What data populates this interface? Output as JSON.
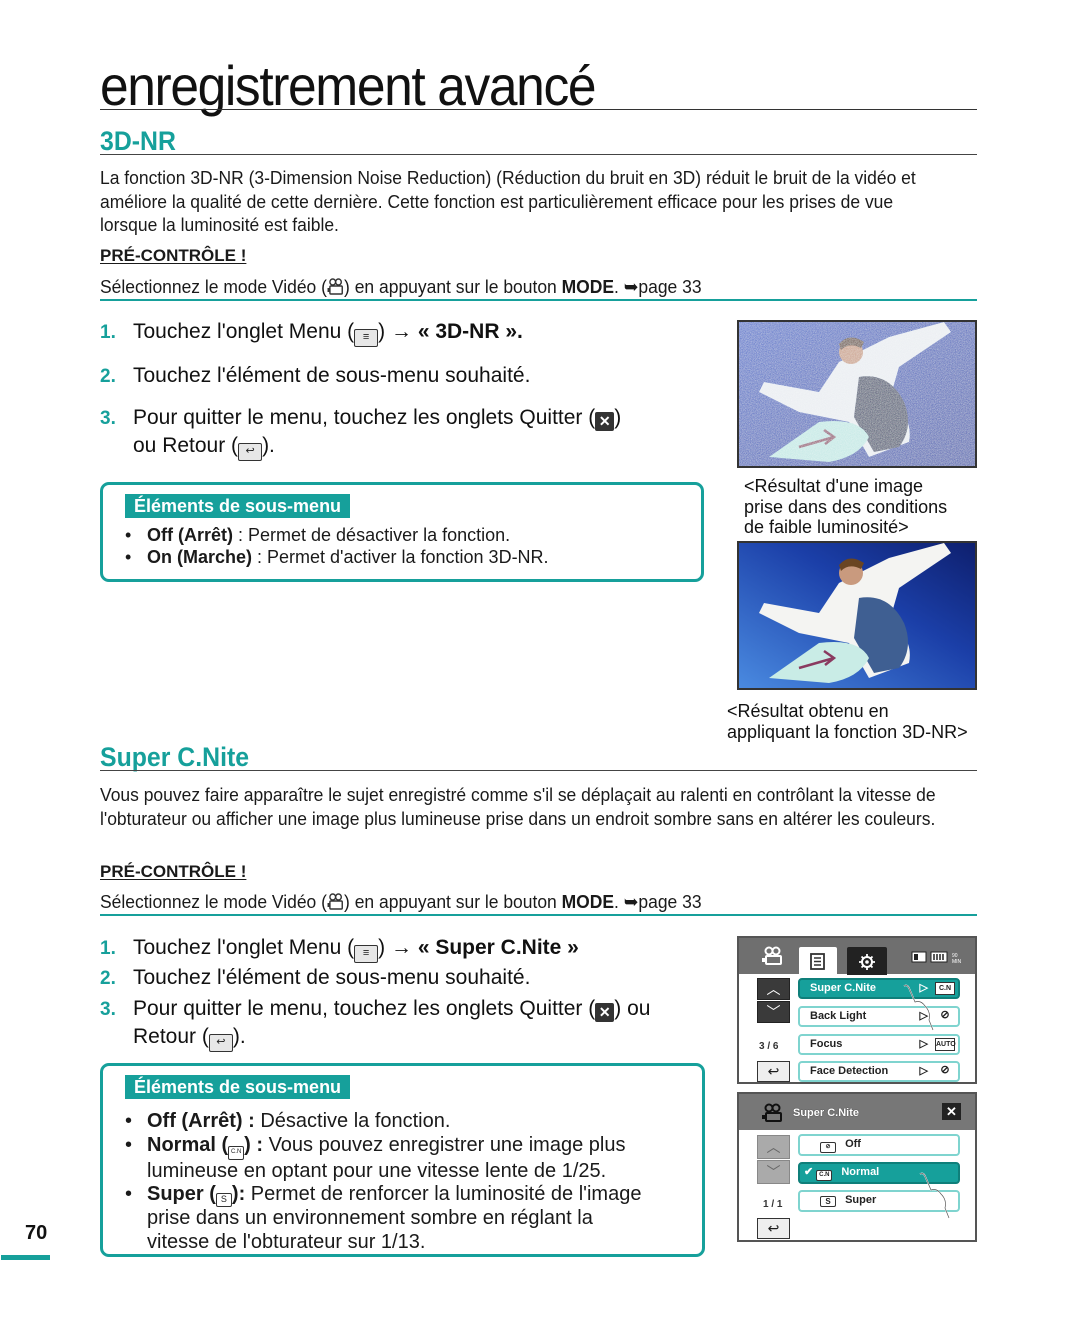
{
  "page": {
    "title": "enregistrement avancé",
    "number": "70",
    "accent_color": "#16a09b"
  },
  "sections": [
    {
      "heading": "3D-NR",
      "intro": "La fonction 3D-NR (3-Dimension Noise Reduction) (Réduction du bruit en 3D) réduit le bruit de la vidéo et améliore la qualité de cette dernière. Cette fonction est particulièrement efficace pour les prises de vue lorsque la luminosité est faible.",
      "precheck_label": "PRÉ-CONTRÔLE !",
      "precheck": {
        "before_icon": "Sélectionnez le mode Vidéo (",
        "after_icon": ") en appuyant sur le bouton ",
        "bold": "MODE",
        "after_bold": ". ➥page 33"
      },
      "steps": [
        {
          "num": "1.",
          "text_before": "Touchez l'onglet Menu (",
          "text_after": ") → ",
          "bold": "« 3D-NR »."
        },
        {
          "num": "2.",
          "text": "Touchez l'élément de sous-menu souhaité."
        },
        {
          "num": "3.",
          "line1_before": "Pour quitter le menu, touchez les onglets Quitter (",
          "line1_after": ")",
          "line2_before": "ou Retour (",
          "line2_after": ")."
        }
      ],
      "submenu": {
        "title": "Éléments de sous-menu",
        "items": [
          {
            "bold": "Off (Arrêt)",
            "text": " : Permet de désactiver la fonction."
          },
          {
            "bold": "On (Marche)",
            "text": " : Permet d'activer la fonction 3D-NR."
          }
        ]
      },
      "images": [
        {
          "caption": "<Résultat d'une image prise dans des conditions de faible luminosité>",
          "caption_lines": [
            "<Résultat d'une image",
            "prise dans des conditions",
            "de faible luminosité>"
          ],
          "state": "noisy"
        },
        {
          "caption": "<Résultat obtenu en appliquant la fonction 3D-NR>",
          "caption_lines": [
            "<Résultat obtenu en",
            "appliquant la fonction 3D-NR>"
          ],
          "state": "clean"
        }
      ]
    },
    {
      "heading": "Super C.Nite",
      "intro": "Vous pouvez faire apparaître le sujet enregistré comme s'il se déplaçait au ralenti en contrôlant la vitesse de l'obturateur ou afficher une image plus lumineuse prise dans un endroit sombre sans en altérer les couleurs.",
      "precheck_label": "PRÉ-CONTRÔLE !",
      "precheck": {
        "before_icon": "Sélectionnez le mode Vidéo (",
        "after_icon": ") en appuyant sur le bouton ",
        "bold": "MODE",
        "after_bold": ". ➥page 33"
      },
      "steps": [
        {
          "num": "1.",
          "text_before": "Touchez l'onglet Menu (",
          "text_after": ") → ",
          "bold": "« Super C.Nite »"
        },
        {
          "num": "2.",
          "text": "Touchez l'élément de sous-menu souhaité."
        },
        {
          "num": "3.",
          "line1_before": "Pour quitter le menu, touchez les onglets Quitter (",
          "line1_after": ") ou",
          "line2_before": "Retour (",
          "line2_after": ")."
        }
      ],
      "submenu": {
        "title": "Éléments de sous-menu",
        "items": [
          {
            "bold": "Off (Arrêt) :",
            "text": " Désactive la fonction."
          },
          {
            "bold": "Normal (",
            "icon": "C.N",
            "bold_after": ") :",
            "line1": " Vous pouvez enregistrer une image plus",
            "line2": "lumineuse en optant pour une vitesse lente de 1/25."
          },
          {
            "bold": "Super (",
            "icon": "S",
            "bold_after": "):",
            "line1": " Permet de renforcer la luminosité de l'image",
            "line2": "prise dans un environnement sombre en réglant la",
            "line3": "vitesse de l'obturateur sur 1/13."
          }
        ]
      },
      "lcd_menu": {
        "tabs": [
          "camera-icon",
          "menu-icon",
          "settings-icon"
        ],
        "status_icons": [
          "card-icon",
          "battery-icon",
          "remaining-time-icon"
        ],
        "remaining": "90 MIN",
        "page": "3 / 6",
        "items": [
          {
            "label": "Super C.Nite",
            "value_icon": "C.N",
            "selected": true
          },
          {
            "label": "Back Light",
            "value_icon": "backlight-off-icon",
            "selected": false
          },
          {
            "label": "Focus",
            "value_icon": "AUTO",
            "selected": false
          },
          {
            "label": "Face Detection",
            "value_icon": "face-detection-off-icon",
            "selected": false
          }
        ]
      },
      "lcd_submenu": {
        "title": "Super C.Nite",
        "page": "1 / 1",
        "options": [
          {
            "label": "Off",
            "icon": "C.N-off",
            "selected": false
          },
          {
            "label": "Normal",
            "icon": "C.N",
            "selected": true
          },
          {
            "label": "Super",
            "icon": "S",
            "selected": false
          }
        ]
      }
    }
  ]
}
